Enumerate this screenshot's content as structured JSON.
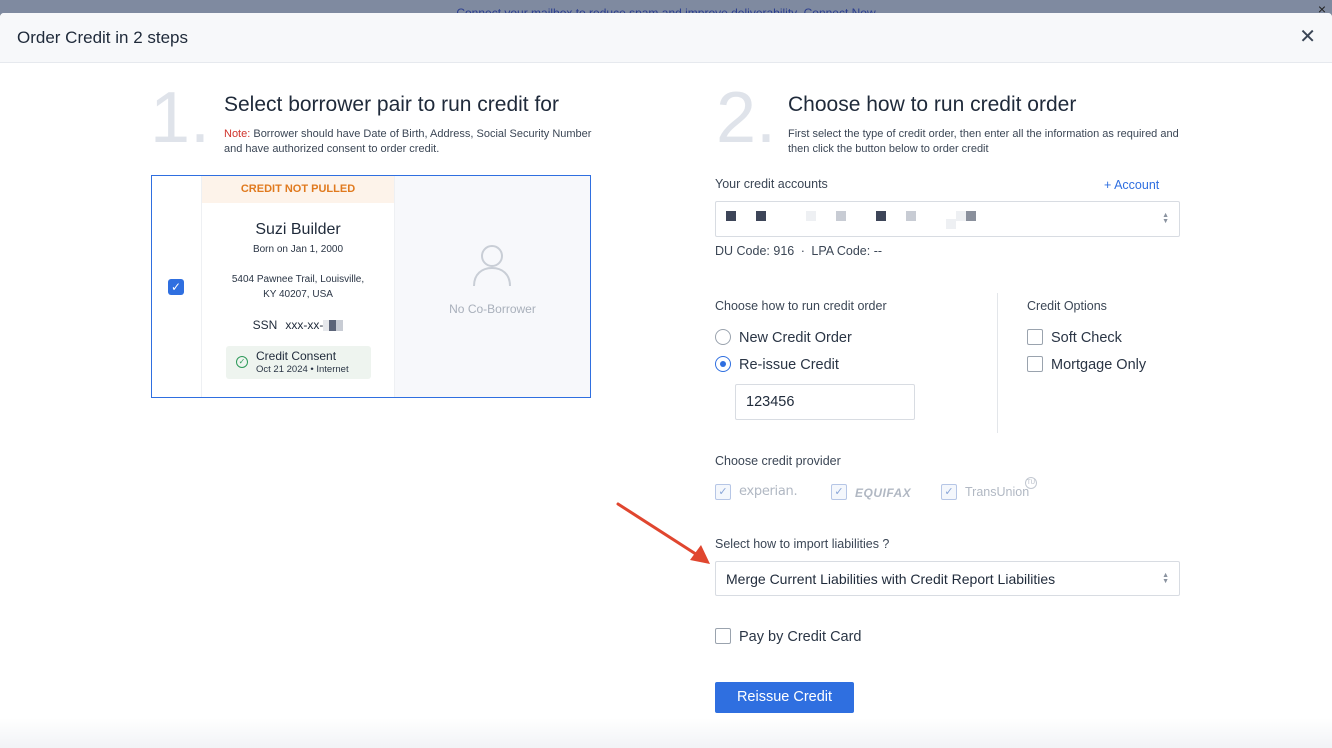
{
  "banner": {
    "text": "Connect your mailbox to reduce spam and improve deliverability.",
    "link": "Connect Now",
    "close": "×"
  },
  "modal": {
    "title": "Order Credit in 2 steps",
    "close": "✕"
  },
  "step1": {
    "number": "1.",
    "title": "Select borrower pair to run credit for",
    "note_label": "Note:",
    "note_text": " Borrower should have Date of Birth, Address, Social Security Number and have authorized consent to order credit."
  },
  "borrower": {
    "status": "CREDIT NOT PULLED",
    "name": "Suzi Builder",
    "born": "Born on Jan 1, 2000",
    "address_line1": "5404 Pawnee Trail, Louisville,",
    "address_line2": "KY 40207, USA",
    "ssn_label": "SSN",
    "ssn_value": "xxx-xx-",
    "consent_title": "Credit Consent",
    "consent_detail": "Oct 21 2024 • Internet",
    "co_borrower": "No Co-Borrower"
  },
  "step2": {
    "number": "2.",
    "title": "Choose how to run credit order",
    "desc": "First select the type of credit order, then enter all the information as required and then click the button below to order credit"
  },
  "accounts": {
    "label": "Your credit accounts",
    "add_link": "+ Account",
    "du_code_label": "DU Code:",
    "du_code": "916",
    "lpa_code_label": "LPA Code:",
    "lpa_code": "--"
  },
  "order": {
    "label": "Choose how to run credit order",
    "options": [
      "New Credit Order",
      "Re-issue Credit"
    ],
    "selected": "Re-issue Credit",
    "reissue_value": "123456"
  },
  "credit_options": {
    "label": "Credit Options",
    "options": [
      "Soft Check",
      "Mortgage Only"
    ]
  },
  "provider": {
    "label": "Choose credit provider",
    "providers": [
      "experian.",
      "EQUIFAX",
      "TransUnion"
    ],
    "tu_mark": "TU"
  },
  "liabilities": {
    "label": "Select how to import liabilities ?",
    "selected": "Merge Current Liabilities with Credit Report Liabilities"
  },
  "pay_card_label": "Pay by Credit Card",
  "submit_label": "Reissue Credit",
  "colors": {
    "accent": "#2f6fe0",
    "warning": "#e07a1f",
    "note": "#d0342c",
    "arrow": "#e0462f"
  }
}
